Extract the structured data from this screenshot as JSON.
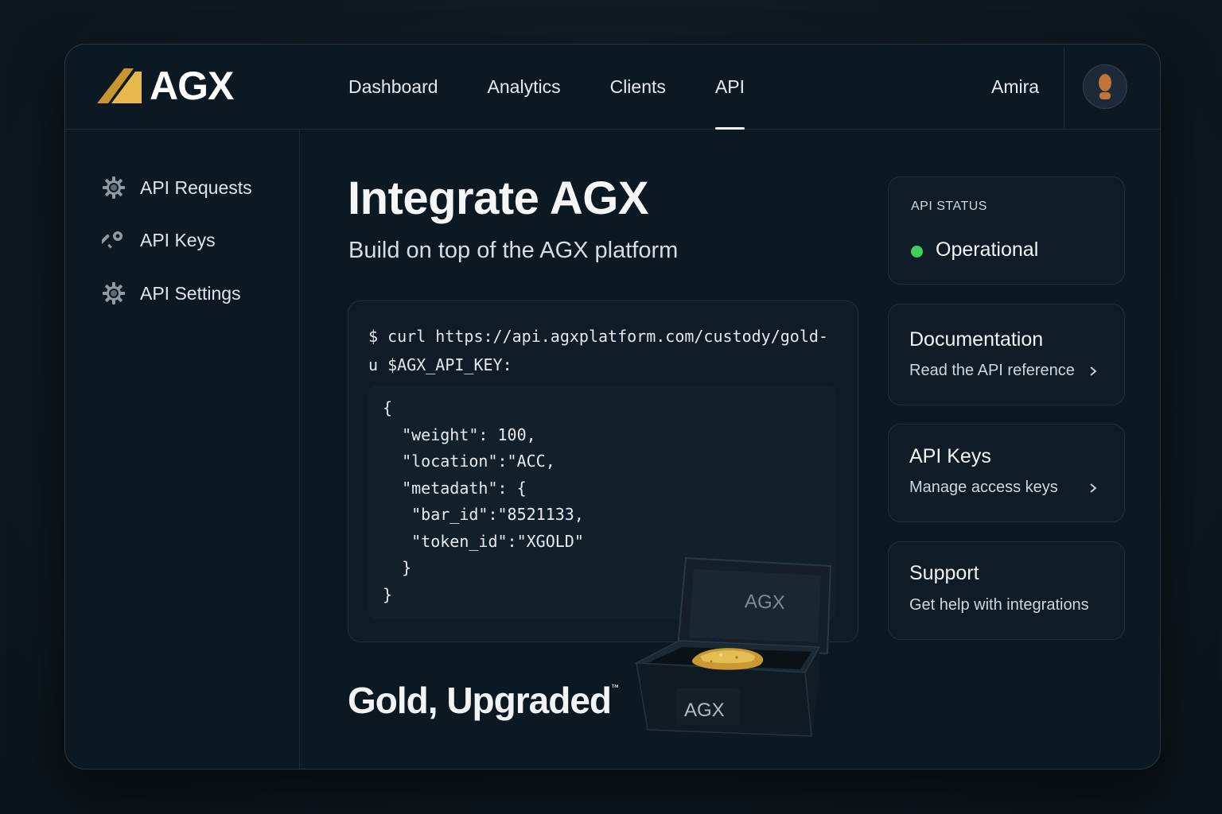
{
  "app": {
    "name": "AGX"
  },
  "nav": {
    "items": [
      {
        "label": "Dashboard"
      },
      {
        "label": "Analytics"
      },
      {
        "label": "Clients"
      },
      {
        "label": "API"
      }
    ],
    "active": "API"
  },
  "user": {
    "name": "Amira"
  },
  "sidebar": {
    "items": [
      {
        "label": "API Requests",
        "icon": "gear-icon"
      },
      {
        "label": "API Keys",
        "icon": "key-icon"
      },
      {
        "label": "API Settings",
        "icon": "gear-icon"
      }
    ]
  },
  "main": {
    "title": "Integrate AGX",
    "subtitle": "Build on top of the AGX platform",
    "code": {
      "command": "$ curl https://api.agxplatform.com/custody/gold-\nu $AGX_API_KEY:",
      "json": "{\n  \"weight\": 100,\n  \"location\":\"ACC,\n  \"metadath\": {\n   \"bar_id\":\"8521133,\n   \"token_id\":\"XGOLD\"\n  }\n}"
    },
    "tagline": "Gold, Upgraded",
    "tagline_mark": "™",
    "box_lid_label": "AGX",
    "box_front_label": "AGX"
  },
  "cards": {
    "status": {
      "label": "API STATUS",
      "value": "Operational",
      "color": "#3fcf5a"
    },
    "documentation": {
      "title": "Documentation",
      "subtitle": "Read the API reference"
    },
    "api_keys": {
      "title": "API Keys",
      "subtitle": "Manage access keys"
    },
    "support": {
      "title": "Support",
      "subtitle": "Get help with integrations"
    }
  },
  "colors": {
    "accent_gold": "#e2b03e",
    "background": "#0c1822"
  }
}
